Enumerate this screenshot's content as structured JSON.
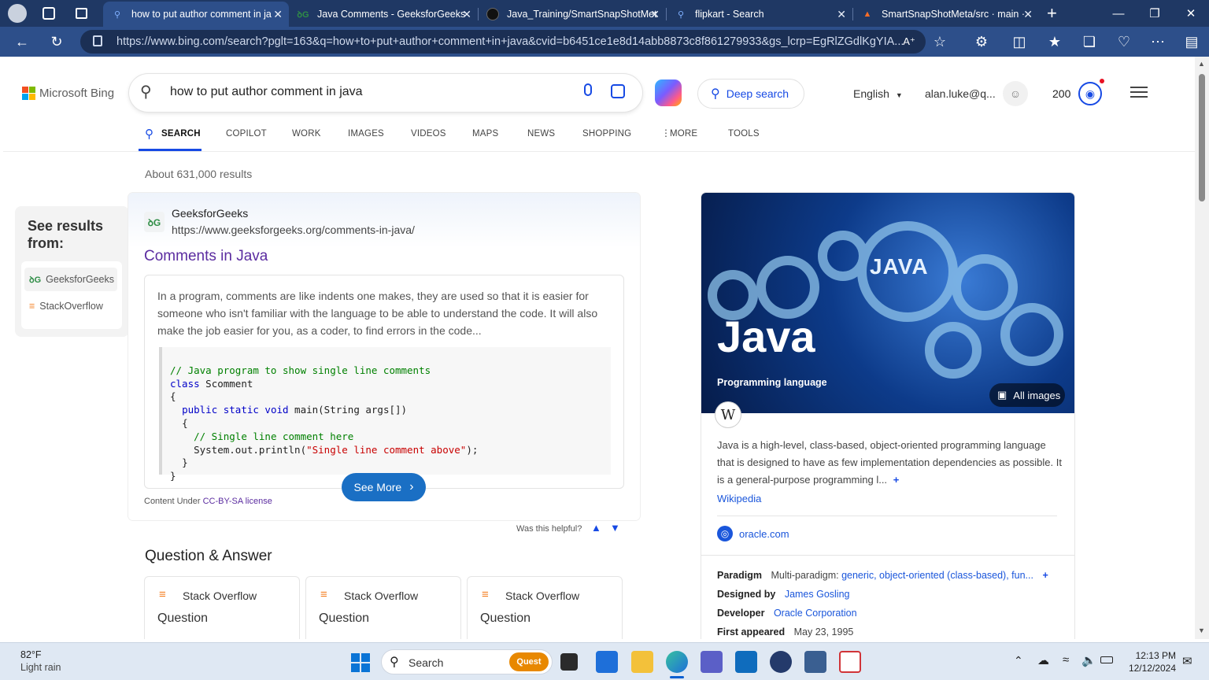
{
  "browser": {
    "tabs": [
      {
        "title": "how to put author comment in ja",
        "active": true
      },
      {
        "title": "Java Comments - GeeksforGeeks"
      },
      {
        "title": "Java_Training/SmartSnapShotMet"
      },
      {
        "title": "flipkart - Search"
      },
      {
        "title": "SmartSnapShotMeta/src · main ·"
      }
    ],
    "url": "https://www.bing.com/search?pglt=163&q=how+to+put+author+comment+in+java&cvid=b6451ce1e8d14abb8873c8f861279933&gs_lcrp=EgRlZGdlKgYIA...",
    "url_host": "www.bing.com"
  },
  "bing": {
    "logo_text": "Microsoft Bing",
    "query": "how to put author comment in java",
    "deep_search": "Deep search",
    "language": "English",
    "account": "alan.luke@q...",
    "points": "200",
    "nav_tabs": [
      "SEARCH",
      "COPILOT",
      "WORK",
      "IMAGES",
      "VIDEOS",
      "MAPS",
      "NEWS",
      "SHOPPING",
      "MORE",
      "TOOLS"
    ],
    "results_count": "About 631,000 results"
  },
  "see_results": {
    "title": "See results from:",
    "items": [
      "GeeksforGeeks",
      "StackOverflow"
    ]
  },
  "result": {
    "site_name": "GeeksforGeeks",
    "site_url": "https://www.geeksforgeeks.org/comments-in-java/",
    "title": "Comments in Java",
    "snippet": "In a program, comments are like indents one makes, they are used so that it is easier for someone who isn't familiar with the language to be able to understand the code. It will also make the job easier for you, as a coder, to find errors in the code...",
    "see_more": "See More",
    "license_prefix": "Content Under",
    "license_link": "CC-BY-SA license",
    "helpful": "Was this helpful?"
  },
  "code": {
    "l1": "// Java program to show single line comments",
    "l2_kw": "class",
    "l2_rest": " Scomment",
    "l3": "{",
    "l4_kw": "public static void",
    "l4_rest": " main(String args[])",
    "l5": "{",
    "l6": "// Single line comment here",
    "l7_a": "System.out.println(",
    "l7_str": "\"Single line comment above\"",
    "l7_b": ");",
    "l8": "}",
    "l9": "}"
  },
  "qa": {
    "heading": "Question & Answer",
    "cards": [
      {
        "source": "Stack Overflow",
        "label": "Question"
      },
      {
        "source": "Stack Overflow",
        "label": "Question"
      },
      {
        "source": "Stack Overflow",
        "label": "Question"
      }
    ]
  },
  "knowledge": {
    "title": "Java",
    "subtitle": "Programming language",
    "image_badge": "JAVA",
    "all_images": "All images",
    "description": "Java is a high-level, class-based, object-oriented programming language that is designed to have as few implementation dependencies as possible. It is a general-purpose programming l...",
    "wiki_link": "Wikipedia",
    "site_link": "oracle.com",
    "paradigm_label": "Paradigm",
    "paradigm_value": "Multi-paradigm:",
    "paradigm_links": "generic, object-oriented (class-based), fun...",
    "designed_label": "Designed by",
    "designed_value": "James Gosling",
    "developer_label": "Developer",
    "developer_value": "Oracle Corporation",
    "first_label": "First appeared",
    "first_value": "May 23, 1995"
  },
  "taskbar": {
    "weather_temp": "82°F",
    "weather_desc": "Light rain",
    "search_placeholder": "Search",
    "time": "12:13 PM",
    "date": "12/12/2024"
  },
  "colors": {
    "titlebar": "#1f3864",
    "accent": "#174ae4",
    "link": "#1a0dab",
    "see_more": "#1a6fc4"
  }
}
